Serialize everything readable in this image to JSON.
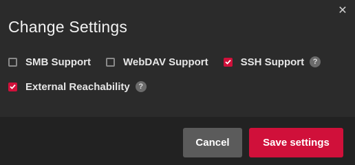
{
  "dialog": {
    "title": "Change Settings",
    "close_icon": "close-icon"
  },
  "options": [
    {
      "label": "SMB Support",
      "checked": false,
      "help": false
    },
    {
      "label": "WebDAV Support",
      "checked": false,
      "help": false
    },
    {
      "label": "SSH Support",
      "checked": true,
      "help": true,
      "help_text": "?"
    },
    {
      "label": "External Reachability",
      "checked": true,
      "help": true,
      "help_text": "?"
    }
  ],
  "footer": {
    "cancel_label": "Cancel",
    "save_label": "Save settings"
  },
  "colors": {
    "accent": "#d0103a",
    "background": "#2b2b2b",
    "footer": "#222222",
    "cancel": "#5b5b5b"
  }
}
